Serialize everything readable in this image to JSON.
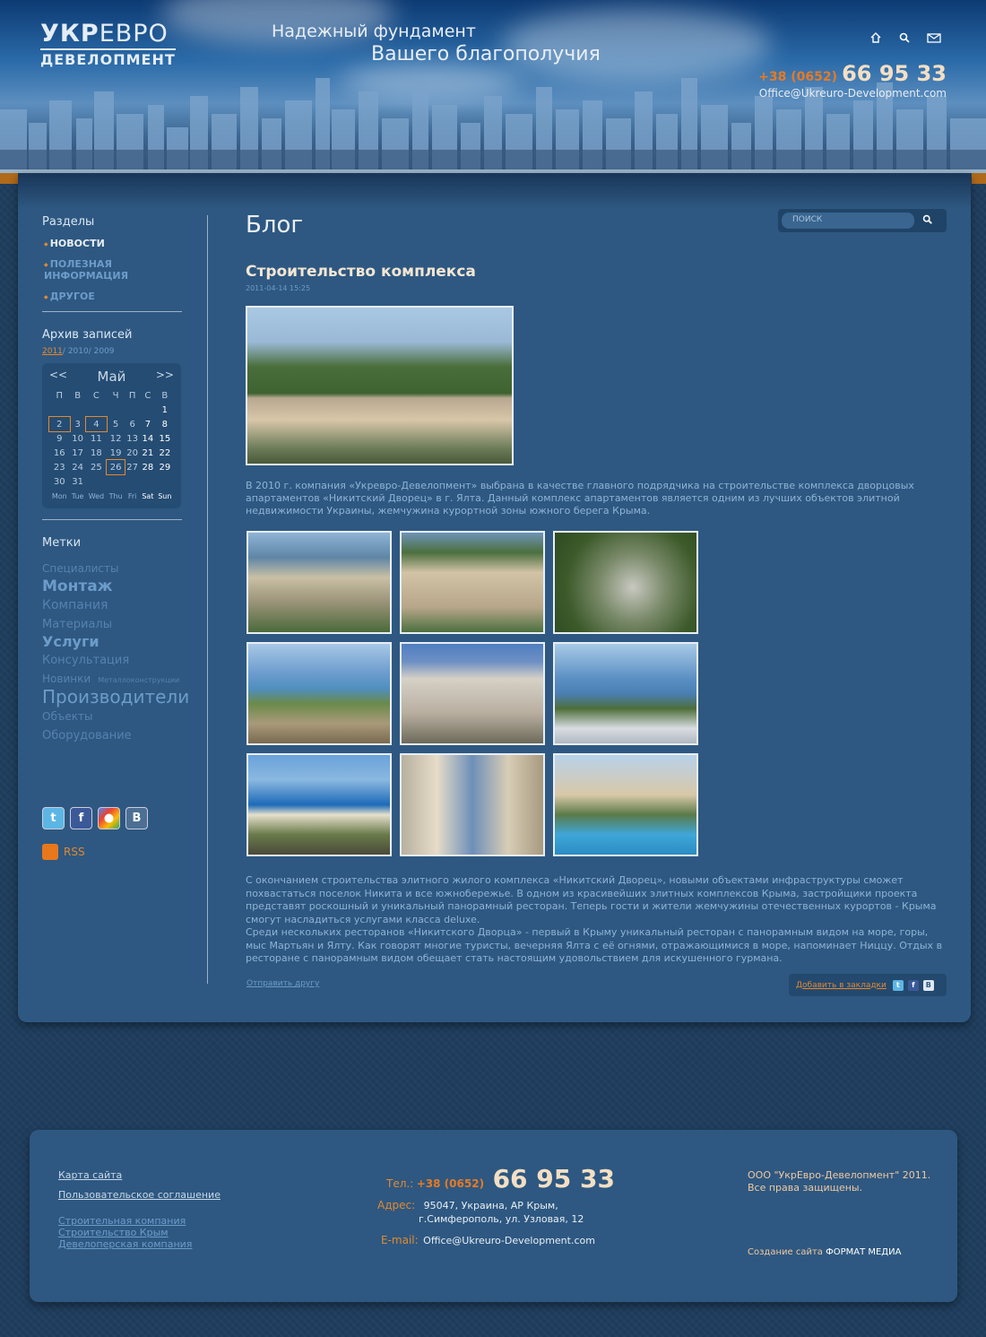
{
  "header": {
    "logo_line1_bold": "УКР",
    "logo_line1_rest": "ЕВРО",
    "logo_line2": "ДЕВЕЛОПМЕНТ",
    "slogan1": "Надежный фундамент",
    "slogan2": "Вашего благополучия",
    "phone_prefix": "+38 (0652)",
    "phone_number": "66 95 33",
    "email": "Office@Ukreuro-Development.com",
    "icons": [
      "home-icon",
      "search-icon",
      "mail-icon"
    ]
  },
  "sidebar": {
    "sections_title": "Разделы",
    "menu": [
      {
        "label": "НОВОСТИ",
        "active": true
      },
      {
        "label": "ПОЛЕЗНАЯ ИНФОРМАЦИЯ"
      },
      {
        "label": "ДРУГОЕ"
      }
    ],
    "archive_title": "Архив записей",
    "years": [
      "2011",
      "2010",
      "2009"
    ],
    "calendar": {
      "prev": "<<",
      "next": ">>",
      "month": "Май",
      "weekdays": [
        "П",
        "В",
        "С",
        "Ч",
        "П",
        "С",
        "В"
      ],
      "weeks": [
        [
          "",
          "",
          "",
          "",
          "",
          "",
          "1"
        ],
        [
          "2",
          "3",
          "4",
          "5",
          "6",
          "7",
          "8"
        ],
        [
          "9",
          "10",
          "11",
          "12",
          "13",
          "14",
          "15"
        ],
        [
          "16",
          "17",
          "18",
          "19",
          "20",
          "21",
          "22"
        ],
        [
          "23",
          "24",
          "25",
          "26",
          "27",
          "28",
          "29"
        ],
        [
          "30",
          "31",
          "",
          "",
          "",
          "",
          ""
        ]
      ],
      "daynames": [
        "Mon",
        "Tue",
        "Wed",
        "Thu",
        "Fri",
        "Sat",
        "Sun"
      ]
    },
    "tags_title": "Метки",
    "tags": [
      "Специалисты",
      "Монтаж",
      "Компания",
      "Материалы",
      "Услуги",
      "Консультация",
      "Новинки",
      "Металлоконструкции",
      "Производители",
      "Объекты",
      "Оборудование"
    ],
    "social": [
      "twitter-icon",
      "facebook-icon",
      "google-buzz-icon",
      "vkontakte-icon"
    ],
    "rss": "RSS"
  },
  "content": {
    "page_title": "Блог",
    "search_placeholder": "ПОИСК",
    "post_title": "Строительство комплекса",
    "post_date": "2011-04-14 15:25",
    "intro": "В 2010 г. компания «Укревро-Девелопмент» выбрана в качестве главного подрядчика на строительстве комплекса дворцовых апартаментов «Никитский Дворец» в г. Ялта. Данный комплекс апартаментов является одним из лучших объектов элитной недвижимости Украины, жемчужина курортной зоны южного берега Крыма.",
    "body1": "С окончанием строительства элитного жилого комплекса «Никитский Дворец», новыми объектами инфраструктуры сможет похвастаться поселок Никита и все южнобережье. В одном из красивейших элитных комплексов Крыма, застройщики проекта представят роскошный и уникальный панорамный ресторан. Теперь гости и жители жемчужины отечественных курортов - Крыма смогут насладиться услугами класса deluxe.",
    "body2": "Среди нескольких ресторанов «Никитского Дворца» - первый в Крыму уникальный ресторан с панорамным видом на море, горы, мыс Мартьян и Ялту. Как говорят многие туристы, вечерняя Ялта с её огнями, отражающимися в море, напоминает Ниццу. Отдых в ресторане с панорамным видом обещает стать настоящим удовольствием для искушенного гурмана.",
    "send_link": "Отправить другу",
    "bookmark_link": "Добавить в закладки"
  },
  "footer": {
    "links": [
      "Карта сайта",
      "Пользовательское соглашение"
    ],
    "seo_links": [
      "Строительная компания",
      "Строительство Крым",
      "Девелоперская компания"
    ],
    "tel_label": "Тел.:",
    "tel_prefix": "+38 (0652)",
    "tel_number": "66 95 33",
    "addr_label": "Адрес:",
    "addr_line1": "95047, Украина, АР Крым,",
    "addr_line2": "г.Симферополь, ул. Узловая, 12",
    "email_label": "E-mail:",
    "email": "Office@Ukreuro-Development.com",
    "copyright1": "ООО \"УкрЕвро-Девелопмент\" 2011.",
    "copyright2": "Все права защищены.",
    "made_by_label": "Создание сайта",
    "made_by": "ФОРМАТ МЕДИА"
  }
}
